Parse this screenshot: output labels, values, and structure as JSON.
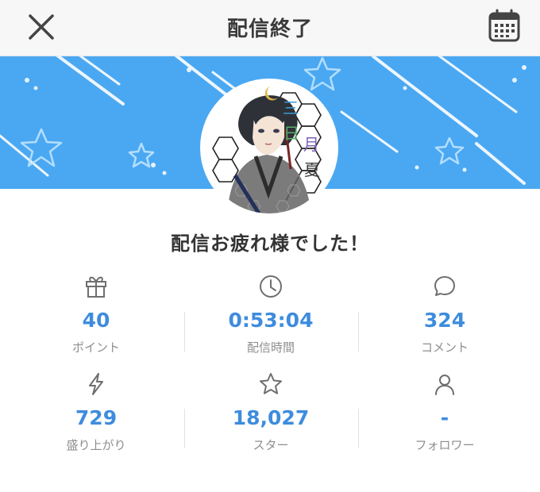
{
  "header": {
    "title": "配信終了",
    "close_icon": "close-icon",
    "calendar_icon": "calendar-icon"
  },
  "banner": {
    "color": "#4aa8f2",
    "decoration": "stars-and-streaks"
  },
  "avatar": {
    "label_chars": [
      "三",
      "日",
      "月",
      "夏"
    ]
  },
  "message": "配信お疲れ様でした！",
  "stats": [
    {
      "icon": "gift-icon",
      "value": "40",
      "label": "ポイント"
    },
    {
      "icon": "clock-icon",
      "value": "0:53:04",
      "label": "配信時間"
    },
    {
      "icon": "comment-icon",
      "value": "324",
      "label": "コメント"
    },
    {
      "icon": "lightning-icon",
      "value": "729",
      "label": "盛り上がり"
    },
    {
      "icon": "star-icon",
      "value": "18,027",
      "label": "スター"
    },
    {
      "icon": "person-icon",
      "value": "-",
      "label": "フォロワー"
    }
  ],
  "colors": {
    "accent": "#3e8cde",
    "label": "#8e8e8e",
    "icon": "#6f6f6f"
  }
}
